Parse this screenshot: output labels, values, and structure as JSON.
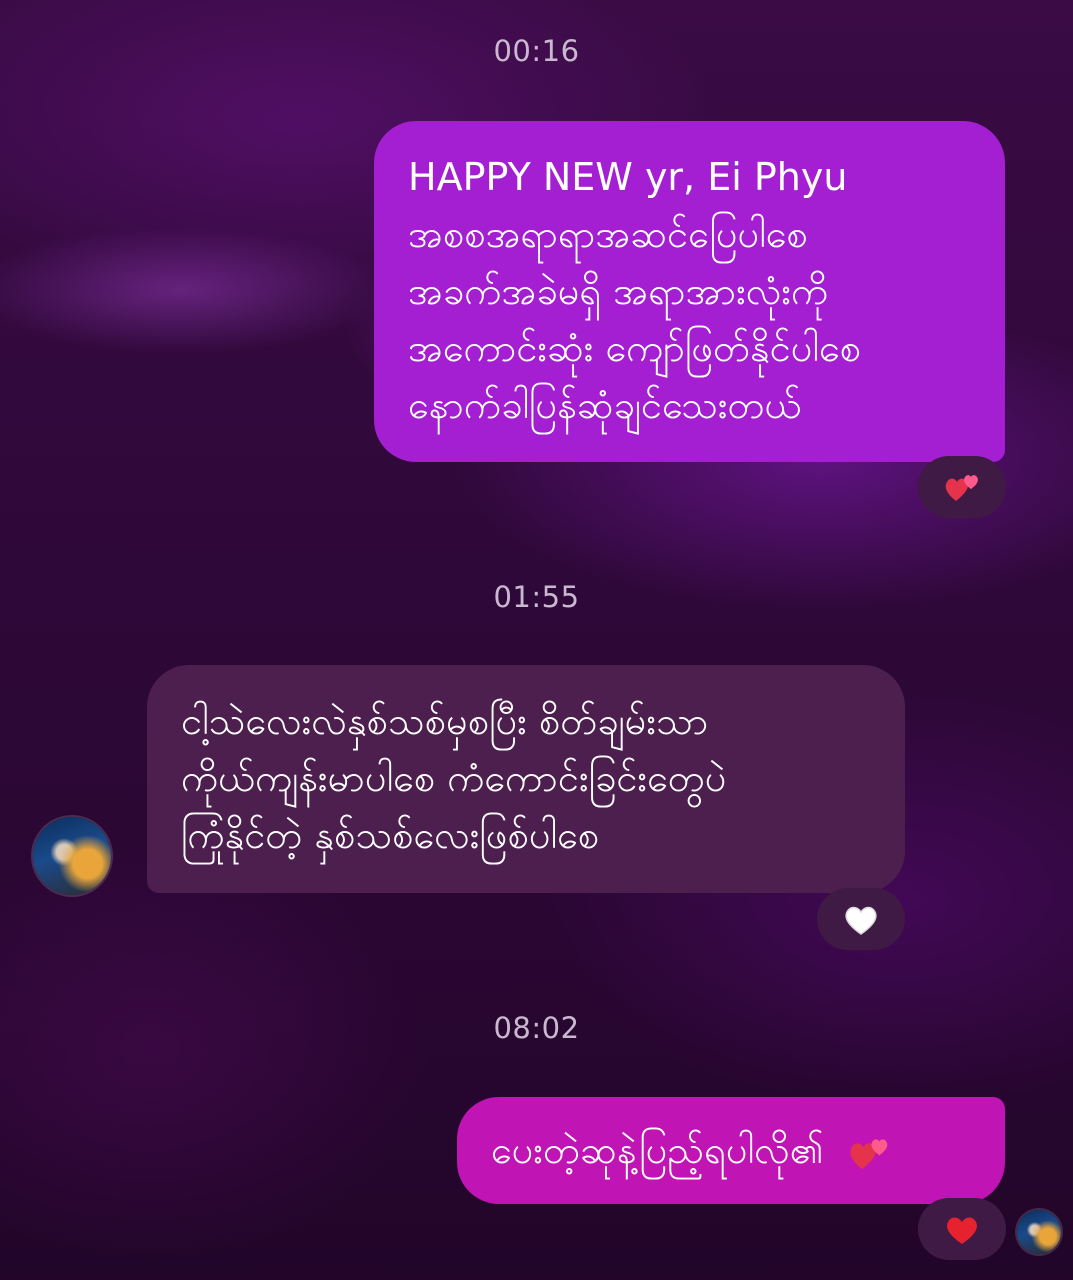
{
  "conversation": {
    "messages": [
      {
        "timestamp": "00:16",
        "direction": "sent",
        "lines": [
          "HAPPY NEW yr,  Ei Phyu",
          "အစစအရာရာအဆင်ပြေပါစေ",
          "အခက်အခဲမရှိ အရာအားလုံးကို",
          "အကောင်းဆုံး ကျော်ဖြတ်နိုင်ပါစေ",
          "နောက်ခါပြန်ဆုံချင်သေးတယ်"
        ],
        "reaction": "two-hearts-icon"
      },
      {
        "timestamp": "01:55",
        "direction": "received",
        "lines": [
          "ငါ့သဲလေးလဲနှစ်သစ်မှစပြီး စိတ်ချမ်းသာ",
          "ကိုယ်ကျန်းမာပါစေ ကံကောင်းခြင်းတွေပဲ",
          "ကြုံနိုင်တဲ့ နှစ်သစ်လေးဖြစ်ပါစေ"
        ],
        "reaction": "white-heart-icon"
      },
      {
        "timestamp": "08:02",
        "direction": "sent",
        "lines": [
          "ပေးတဲ့ဆုနဲ့ပြည့်ရပါလို၏"
        ],
        "trailing_emoji": "two-hearts-icon",
        "reaction": "red-heart-icon"
      }
    ]
  },
  "colors": {
    "sent_bubble": "#a31fd1",
    "sent_bubble_latest": "#c014b4",
    "received_bubble": "#4c1f4e",
    "reaction_pill": "#3e1a44",
    "timestamp_text": "#c9b8cf"
  }
}
